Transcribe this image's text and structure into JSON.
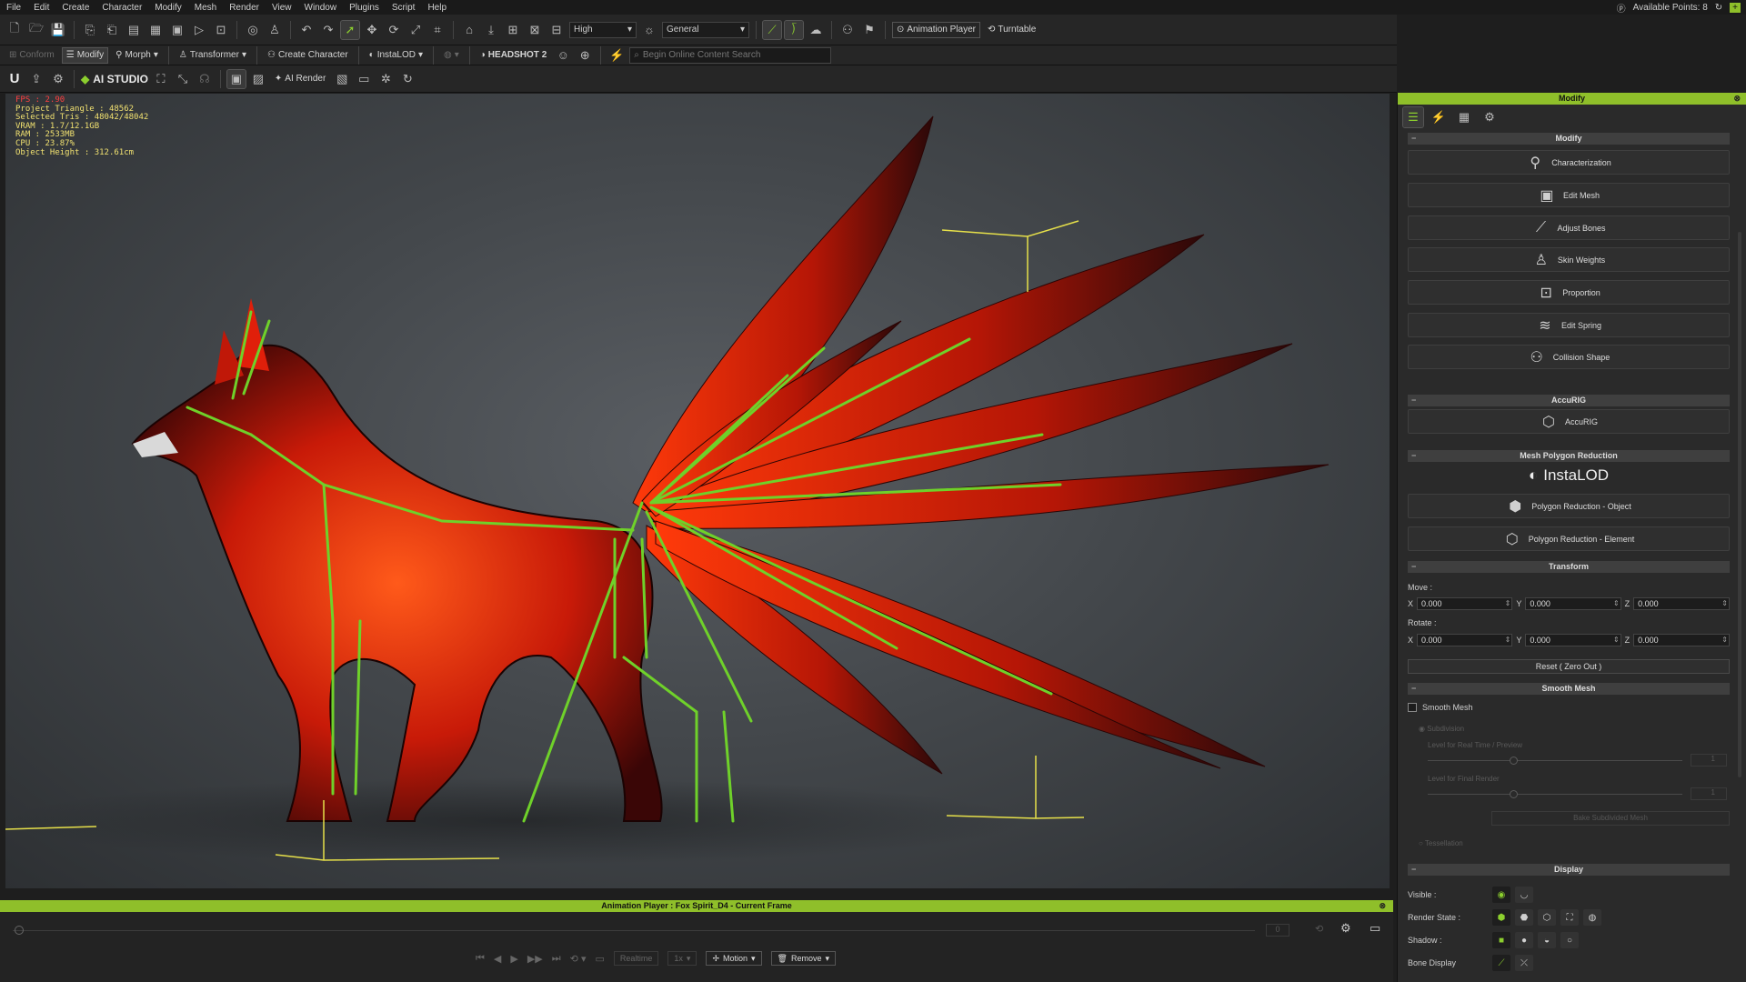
{
  "menu": [
    "File",
    "Edit",
    "Create",
    "Character",
    "Modify",
    "Mesh",
    "Render",
    "View",
    "Window",
    "Plugins",
    "Script",
    "Help"
  ],
  "available_points": "Available Points: 8",
  "toolbar1": {
    "quality": "High",
    "shading": "General",
    "animation_player": "Animation Player",
    "turntable": "Turntable"
  },
  "toolbar2": {
    "conform": "Conform",
    "modify": "Modify",
    "morph": "Morph",
    "transformer": "Transformer",
    "create_character": "Create Character",
    "instalod": "InstaLOD",
    "headshot": "HEADSHOT 2",
    "search_placeholder": "Begin Online Content Search"
  },
  "toolbar3": {
    "ai_studio": "AI STUDIO",
    "ai_render": "AI Render"
  },
  "stats": {
    "fps": "FPS : 2.90",
    "project_triangle": "Project Triangle : 48562",
    "selected_tris": "Selected Tris : 48042/48042",
    "vram": "VRAM : 1.7/12.1GB",
    "ram": "RAM : 2533MB",
    "cpu": "CPU : 23.87%",
    "object_height": "Object Height : 312.61cm"
  },
  "panel": {
    "title": "Modify",
    "sections": {
      "modify": "Modify",
      "accurig": "AccuRIG",
      "mesh_polygon_reduction": "Mesh Polygon Reduction",
      "transform": "Transform",
      "smooth_mesh": "Smooth Mesh",
      "display": "Display"
    },
    "modify_buttons": [
      "Characterization",
      "Edit Mesh",
      "Adjust Bones",
      "Skin Weights",
      "Proportion",
      "Edit Spring",
      "Collision Shape"
    ],
    "accurig_button": "AccuRIG",
    "instalod_logo": "InstaLOD",
    "poly_object": "Polygon Reduction - Object",
    "poly_element": "Polygon Reduction - Element",
    "move_label": "Move :",
    "rotate_label": "Rotate :",
    "move": {
      "x": "0.000",
      "y": "0.000",
      "z": "0.000"
    },
    "rotate": {
      "x": "0.000",
      "y": "0.000",
      "z": "0.000"
    },
    "axis": {
      "x": "X",
      "y": "Y",
      "z": "Z"
    },
    "reset": "Reset ( Zero Out )",
    "smooth_mesh_check": "Smooth Mesh",
    "subdivision": "Subdivision",
    "level_realtime": "Level for Real Time / Preview",
    "level_final": "Level for Final Render",
    "bake_button": "Bake Subdivided Mesh",
    "tessellation": "Tessellation",
    "level_realtime_value": "1",
    "level_final_value": "1",
    "display_rows": {
      "visible": "Visible :",
      "render_state": "Render State :",
      "shadow": "Shadow :",
      "bone_display": "Bone Display"
    }
  },
  "anim": {
    "title": "Animation Player : Fox Spirit_D4 - Current Frame",
    "frame": "0",
    "realtime": "Realtime",
    "speed": "1x",
    "motion": "Motion",
    "remove": "Remove"
  },
  "colors": {
    "accent": "#8fbf2a",
    "bone": "#6fd12a",
    "fps": "#ff4040",
    "stats": "#f0e070"
  }
}
